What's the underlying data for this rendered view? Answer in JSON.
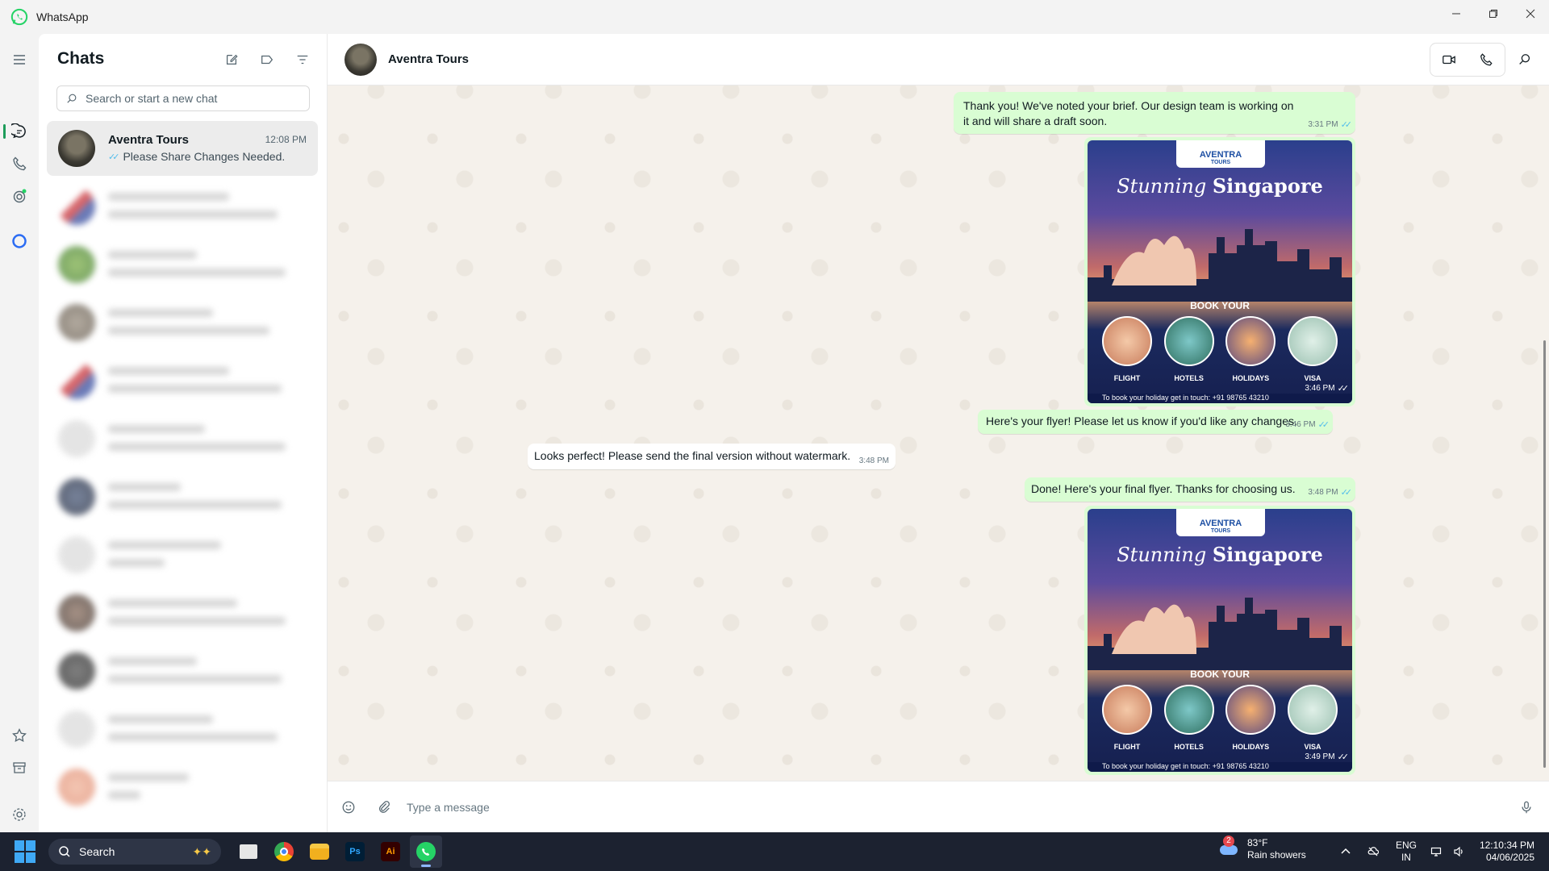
{
  "app": {
    "title": "WhatsApp"
  },
  "chat_list": {
    "title": "Chats",
    "search_placeholder": "Search or start a new chat",
    "active_chat": {
      "name": "Aventra Tours",
      "time": "12:08 PM",
      "preview": "Please Share Changes Needed."
    }
  },
  "conversation": {
    "contact_name": "Aventra Tours",
    "messages": [
      {
        "direction": "out",
        "text": "Thank you! We've noted your brief. Our design team is working on it and will share a draft soon.",
        "time": "3:31 PM"
      },
      {
        "direction": "out",
        "type": "image",
        "time": "3:46 PM"
      },
      {
        "direction": "out",
        "text": "Here's your flyer! Please let us know if you'd like any changes.",
        "time": "3:46 PM"
      },
      {
        "direction": "in",
        "text": "Looks perfect! Please send the final version without watermark.",
        "time": "3:48 PM"
      },
      {
        "direction": "out",
        "text": "Done! Here's your final flyer. Thanks for choosing us.",
        "time": "3:48 PM"
      },
      {
        "direction": "out",
        "type": "image",
        "time": "3:49 PM"
      }
    ],
    "flyer": {
      "brand": "AVENTRA",
      "brand_sub": "TOURS",
      "headline_italic": "Stunning",
      "headline_bold": "Singapore",
      "book_your": "BOOK YOUR",
      "services": [
        "FLIGHT",
        "HOTELS",
        "HOLIDAYS",
        "VISA"
      ],
      "footer": "To book your holiday get in touch:  +91 98765 43210"
    },
    "composer_placeholder": "Type a message"
  },
  "taskbar": {
    "search_label": "Search",
    "weather": {
      "badge": "2",
      "temp": "83°F",
      "condition": "Rain showers"
    },
    "lang_top": "ENG",
    "lang_bottom": "IN",
    "time": "12:10:34 PM",
    "date": "04/06/2025",
    "apps": [
      "chrome",
      "file-explorer",
      "photoshop",
      "illustrator",
      "whatsapp"
    ],
    "ps_label": "Ps",
    "ai_label": "Ai"
  },
  "colors": {
    "accent": "#1d9c5a",
    "outgoing_bubble": "#d9fdd3",
    "read_ticks": "#53bdeb",
    "taskbar": "#1c2230"
  }
}
